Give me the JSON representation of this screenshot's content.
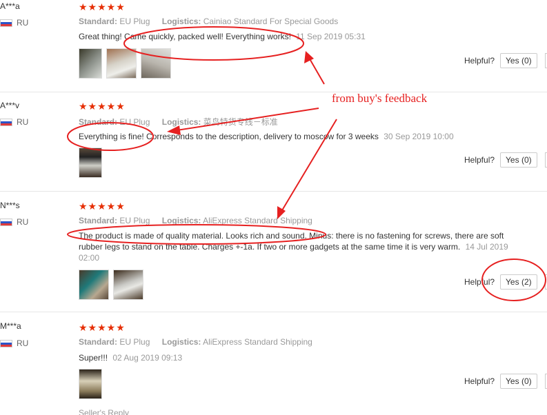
{
  "reviews": [
    {
      "user": "A***a",
      "country": "RU",
      "stars": "★★★★★",
      "standard_label": "Standard:",
      "standard_value": "EU Plug",
      "logistics_label": "Logistics:",
      "logistics_value": "Cainiao Standard For Special Goods",
      "text": "Great thing! Came quickly, packed well! Everything works!",
      "date": "11 Sep 2019 05:31",
      "helpful_label": "Helpful?",
      "yes_label": "Yes (0)"
    },
    {
      "user": "A***v",
      "country": "RU",
      "stars": "★★★★★",
      "standard_label": "Standard:",
      "standard_value": "EU Plug",
      "logistics_label": "Logistics:",
      "logistics_value": "菜鸟特货专线－标准",
      "text": "Everything is fine! Corresponds to the description, delivery to moscow for 3 weeks",
      "date": "30 Sep 2019 10:00",
      "helpful_label": "Helpful?",
      "yes_label": "Yes (0)"
    },
    {
      "user": "N***s",
      "country": "RU",
      "stars": "★★★★★",
      "standard_label": "Standard:",
      "standard_value": "EU Plug",
      "logistics_label": "Logistics:",
      "logistics_value": "AliExpress Standard Shipping",
      "text": "The product is made of quality material. Looks rich and sound. Minus: there is no fastening for screws, there are soft rubber legs to stand on the table. Charges +-1a. If two or more gadgets at the same time it is very warm.",
      "date": "14 Jul 2019 02:00",
      "helpful_label": "Helpful?",
      "yes_label": "Yes (2)"
    },
    {
      "user": "M***a",
      "country": "RU",
      "stars": "★★★★★",
      "standard_label": "Standard:",
      "standard_value": "EU Plug",
      "logistics_label": "Logistics:",
      "logistics_value": "AliExpress Standard Shipping",
      "text": "Super!!!",
      "date": "02 Aug 2019 09:13",
      "helpful_label": "Helpful?",
      "yes_label": "Yes (0)"
    }
  ],
  "seller_reply_label": "Seller's Reply",
  "annotation": {
    "text": "from buy's feedback",
    "color": "#e62020"
  },
  "colors": {
    "stars": "#e62e04",
    "meta": "#999999"
  }
}
